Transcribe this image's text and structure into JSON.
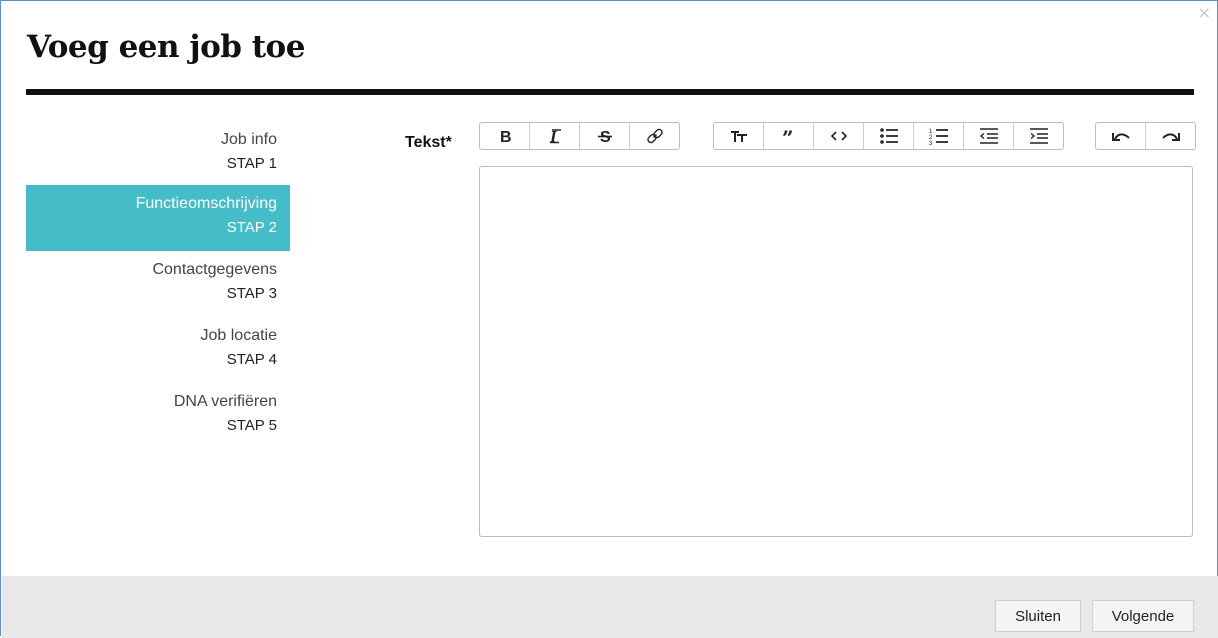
{
  "dialog": {
    "title": "Voeg een job toe",
    "close_glyph": "×"
  },
  "steps": [
    {
      "name": "Job info",
      "num": "STAP 1",
      "active": false
    },
    {
      "name": "Functieomschrijving",
      "num": "STAP 2",
      "active": true
    },
    {
      "name": "Contactgegevens",
      "num": "STAP 3",
      "active": false
    },
    {
      "name": "Job locatie",
      "num": "STAP 4",
      "active": false
    },
    {
      "name": "DNA verifiëren",
      "num": "STAP 5",
      "active": false
    }
  ],
  "editor": {
    "label": "Tekst*",
    "value": ""
  },
  "toolbar": {
    "formatting": [
      "bold-icon",
      "italic-icon",
      "strikethrough-icon",
      "link-icon"
    ],
    "blocks": [
      "heading-icon",
      "quote-icon",
      "code-icon",
      "bullet-list-icon",
      "numbered-list-icon",
      "outdent-icon",
      "indent-icon"
    ],
    "history": [
      "undo-icon",
      "redo-icon"
    ]
  },
  "footer": {
    "close_label": "Sluiten",
    "next_label": "Volgende"
  },
  "colors": {
    "active_step": "#44bdc9",
    "title_rule": "#111111",
    "footer_bg": "#e8e8e8"
  }
}
